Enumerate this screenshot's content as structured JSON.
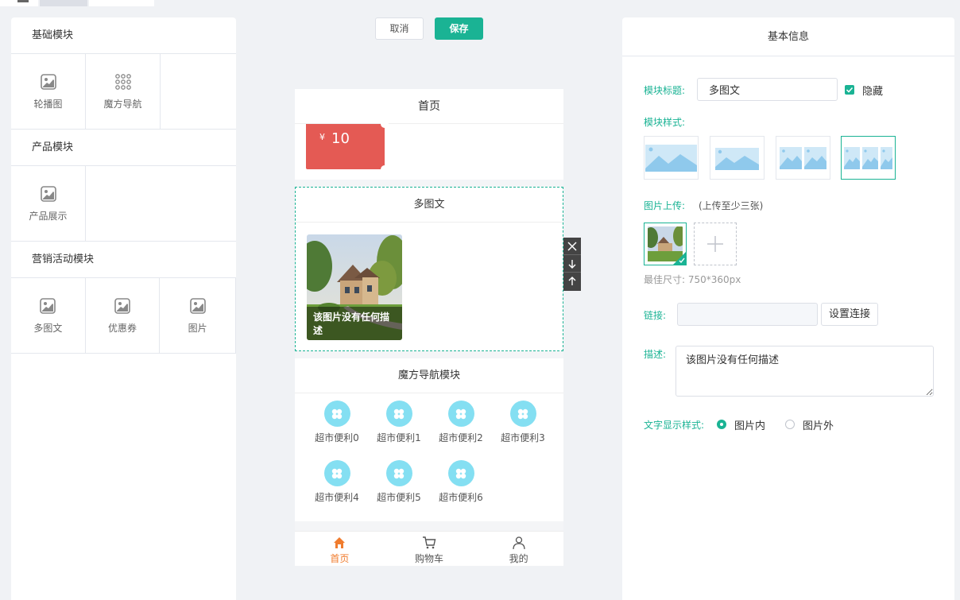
{
  "left_panel": {
    "sections": [
      {
        "title": "基础模块",
        "items": [
          {
            "label": "轮播图",
            "icon": "image-icon"
          },
          {
            "label": "魔方导航",
            "icon": "grid-dots-icon"
          }
        ]
      },
      {
        "title": "产品模块",
        "items": [
          {
            "label": "产品展示",
            "icon": "image-icon"
          }
        ]
      },
      {
        "title": "营销活动模块",
        "items": [
          {
            "label": "多图文",
            "icon": "image-icon"
          },
          {
            "label": "优惠券",
            "icon": "image-icon"
          },
          {
            "label": "图片",
            "icon": "image-icon"
          }
        ]
      }
    ]
  },
  "toolbar": {
    "cancel_label": "取消",
    "save_label": "保存"
  },
  "preview": {
    "page_title": "首页",
    "coupon": {
      "currency": "¥",
      "amount": "10"
    },
    "multi_block": {
      "title": "多图文",
      "caption": "该图片没有任何描述"
    },
    "cube_block": {
      "title": "魔方导航模块",
      "items": [
        "超市便利0",
        "超市便利1",
        "超市便利2",
        "超市便利3",
        "超市便利4",
        "超市便利5",
        "超市便利6"
      ]
    },
    "tabbar": [
      {
        "label": "首页",
        "icon": "home-icon",
        "active": true
      },
      {
        "label": "购物车",
        "icon": "cart-icon",
        "active": false
      },
      {
        "label": "我的",
        "icon": "user-icon",
        "active": false
      }
    ]
  },
  "right_panel": {
    "title": "基本信息",
    "module_title_label": "模块标题:",
    "module_title_value": "多图文",
    "hide_label": "隐藏",
    "hide_checked": true,
    "style_label": "模块样式:",
    "upload_label": "图片上传:",
    "upload_hint": "(上传至少三张)",
    "size_tip": "最佳尺寸: 750*360px",
    "link_label": "链接:",
    "link_button": "设置连接",
    "desc_label": "描述:",
    "desc_value": "该图片没有任何描述",
    "text_style_label": "文字显示样式:",
    "text_style_options": [
      "图片内",
      "图片外"
    ],
    "text_style_selected": "图片内"
  },
  "colors": {
    "accent": "#1ab394",
    "coupon_red": "#e45a54",
    "tab_active": "#f07c2e",
    "cube_circle": "#84dff2"
  }
}
